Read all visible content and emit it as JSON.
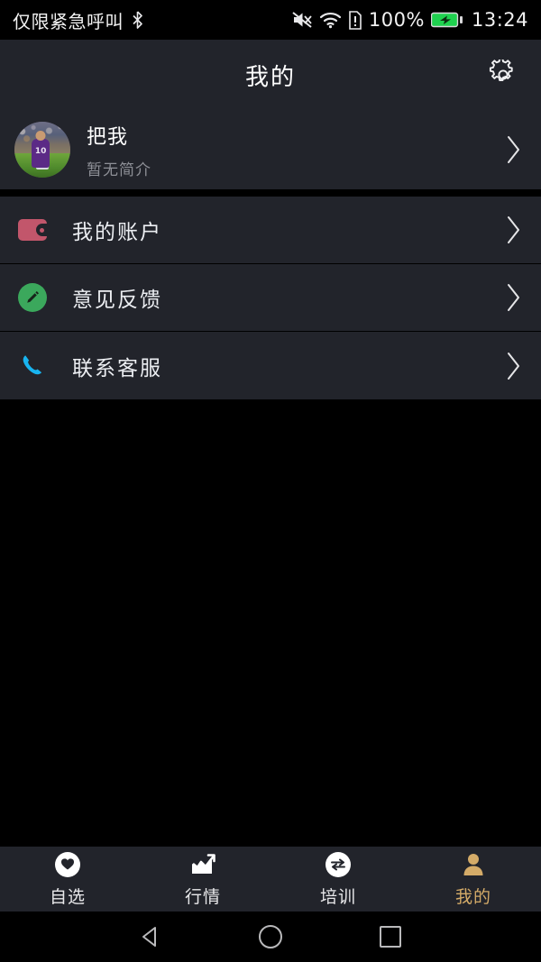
{
  "status_bar": {
    "carrier": "仅限紧急呼叫",
    "bluetooth_icon": "bluetooth-icon",
    "mute_icon": "speaker-muted-icon",
    "wifi_icon": "wifi-icon",
    "sim_alert_icon": "sim-alert-icon",
    "battery_percent": "100%",
    "battery_icon": "battery-charging-icon",
    "time": "13:24"
  },
  "header": {
    "title": "我的",
    "settings_icon": "gear-icon"
  },
  "profile": {
    "name": "把我",
    "subtitle": "暂无简介",
    "avatar_alt": "avatar",
    "chevron_icon": "chevron-right-icon"
  },
  "menu": {
    "items": [
      {
        "label": "我的账户",
        "icon": "wallet-icon",
        "icon_color": "#c2566b",
        "chevron_icon": "chevron-right-icon"
      },
      {
        "label": "意见反馈",
        "icon": "pencil-icon",
        "icon_color": "#3ba85c",
        "chevron_icon": "chevron-right-icon"
      },
      {
        "label": "联系客服",
        "icon": "phone-icon",
        "icon_color": "#18b4f0",
        "chevron_icon": "chevron-right-icon"
      }
    ]
  },
  "tab_bar": {
    "active_color": "#d4ab68",
    "inactive_color": "#e8e8ea",
    "tabs": [
      {
        "label": "自选",
        "icon": "heart-circle-icon",
        "active": false
      },
      {
        "label": "行情",
        "icon": "trending-chart-icon",
        "active": false
      },
      {
        "label": "培训",
        "icon": "swap-circle-icon",
        "active": false
      },
      {
        "label": "我的",
        "icon": "person-icon",
        "active": true
      }
    ]
  },
  "nav_bar": {
    "back_icon": "back-triangle-icon",
    "home_icon": "home-circle-icon",
    "recents_icon": "recents-square-icon"
  },
  "theme": {
    "background": "#000000",
    "surface": "#22242b",
    "text_primary": "#ffffff",
    "text_secondary": "#8d8f96"
  }
}
